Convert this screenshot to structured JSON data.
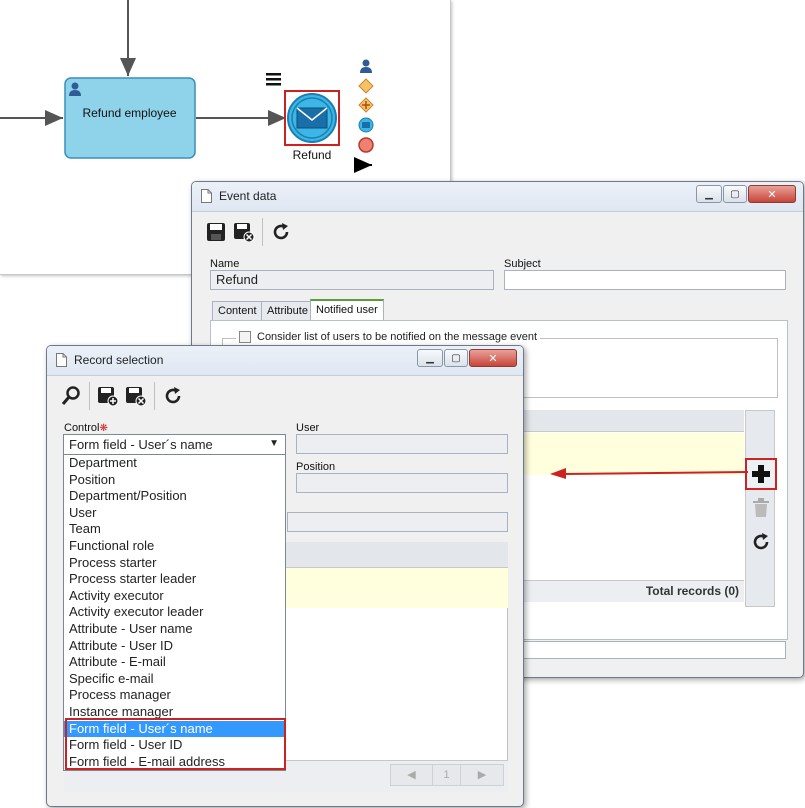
{
  "diagram": {
    "task_label": "Refund employee",
    "event_label": "Refund",
    "palette_icons": [
      "person-icon",
      "gateway-icon",
      "parallel-gateway-icon",
      "message-event-icon",
      "end-event-icon",
      "sequence-flow-icon"
    ]
  },
  "event_window": {
    "title": "Event data",
    "toolbar": [
      "save-icon",
      "save-close-icon",
      "refresh-icon"
    ],
    "name_label": "Name",
    "name_value": "Refund",
    "subject_label": "Subject",
    "subject_value": "",
    "tabs": [
      "Content",
      "Attribute",
      "Notified user"
    ],
    "active_tab": "Notified user",
    "consider_label": "Consider list of users to be notified on the message event",
    "total_records": "Total records (0)",
    "side_buttons": [
      "add-icon",
      "delete-icon",
      "refresh-icon"
    ]
  },
  "record_window": {
    "title": "Record selection",
    "toolbar": [
      "search-icon",
      "save-new-icon",
      "save-close-icon",
      "refresh-icon"
    ],
    "control_label": "Control",
    "control_value": "Form field - User´s name",
    "user_label": "User",
    "position_label": "Position",
    "options": [
      "Department",
      "Position",
      "Department/Position",
      "User",
      "Team",
      "Functional role",
      "Process starter",
      "Process starter leader",
      "Activity executor",
      "Activity executor leader",
      "Attribute - User name",
      "Attribute - User ID",
      "Attribute - E-mail",
      "Specific e-mail",
      "Process manager",
      "Instance manager",
      "Form field - User´s name",
      "Form field - User ID",
      "Form field - E-mail address"
    ],
    "selected_option": "Form field - User´s name",
    "pager": {
      "prev": "◀",
      "page": "1",
      "next": "▶"
    }
  },
  "colors": {
    "task_fill": "#8fd3ea",
    "task_stroke": "#3a8fb7",
    "highlight_red": "#cc2222",
    "selection_blue": "#3399ff",
    "grid_yellow": "#ffffdd"
  }
}
